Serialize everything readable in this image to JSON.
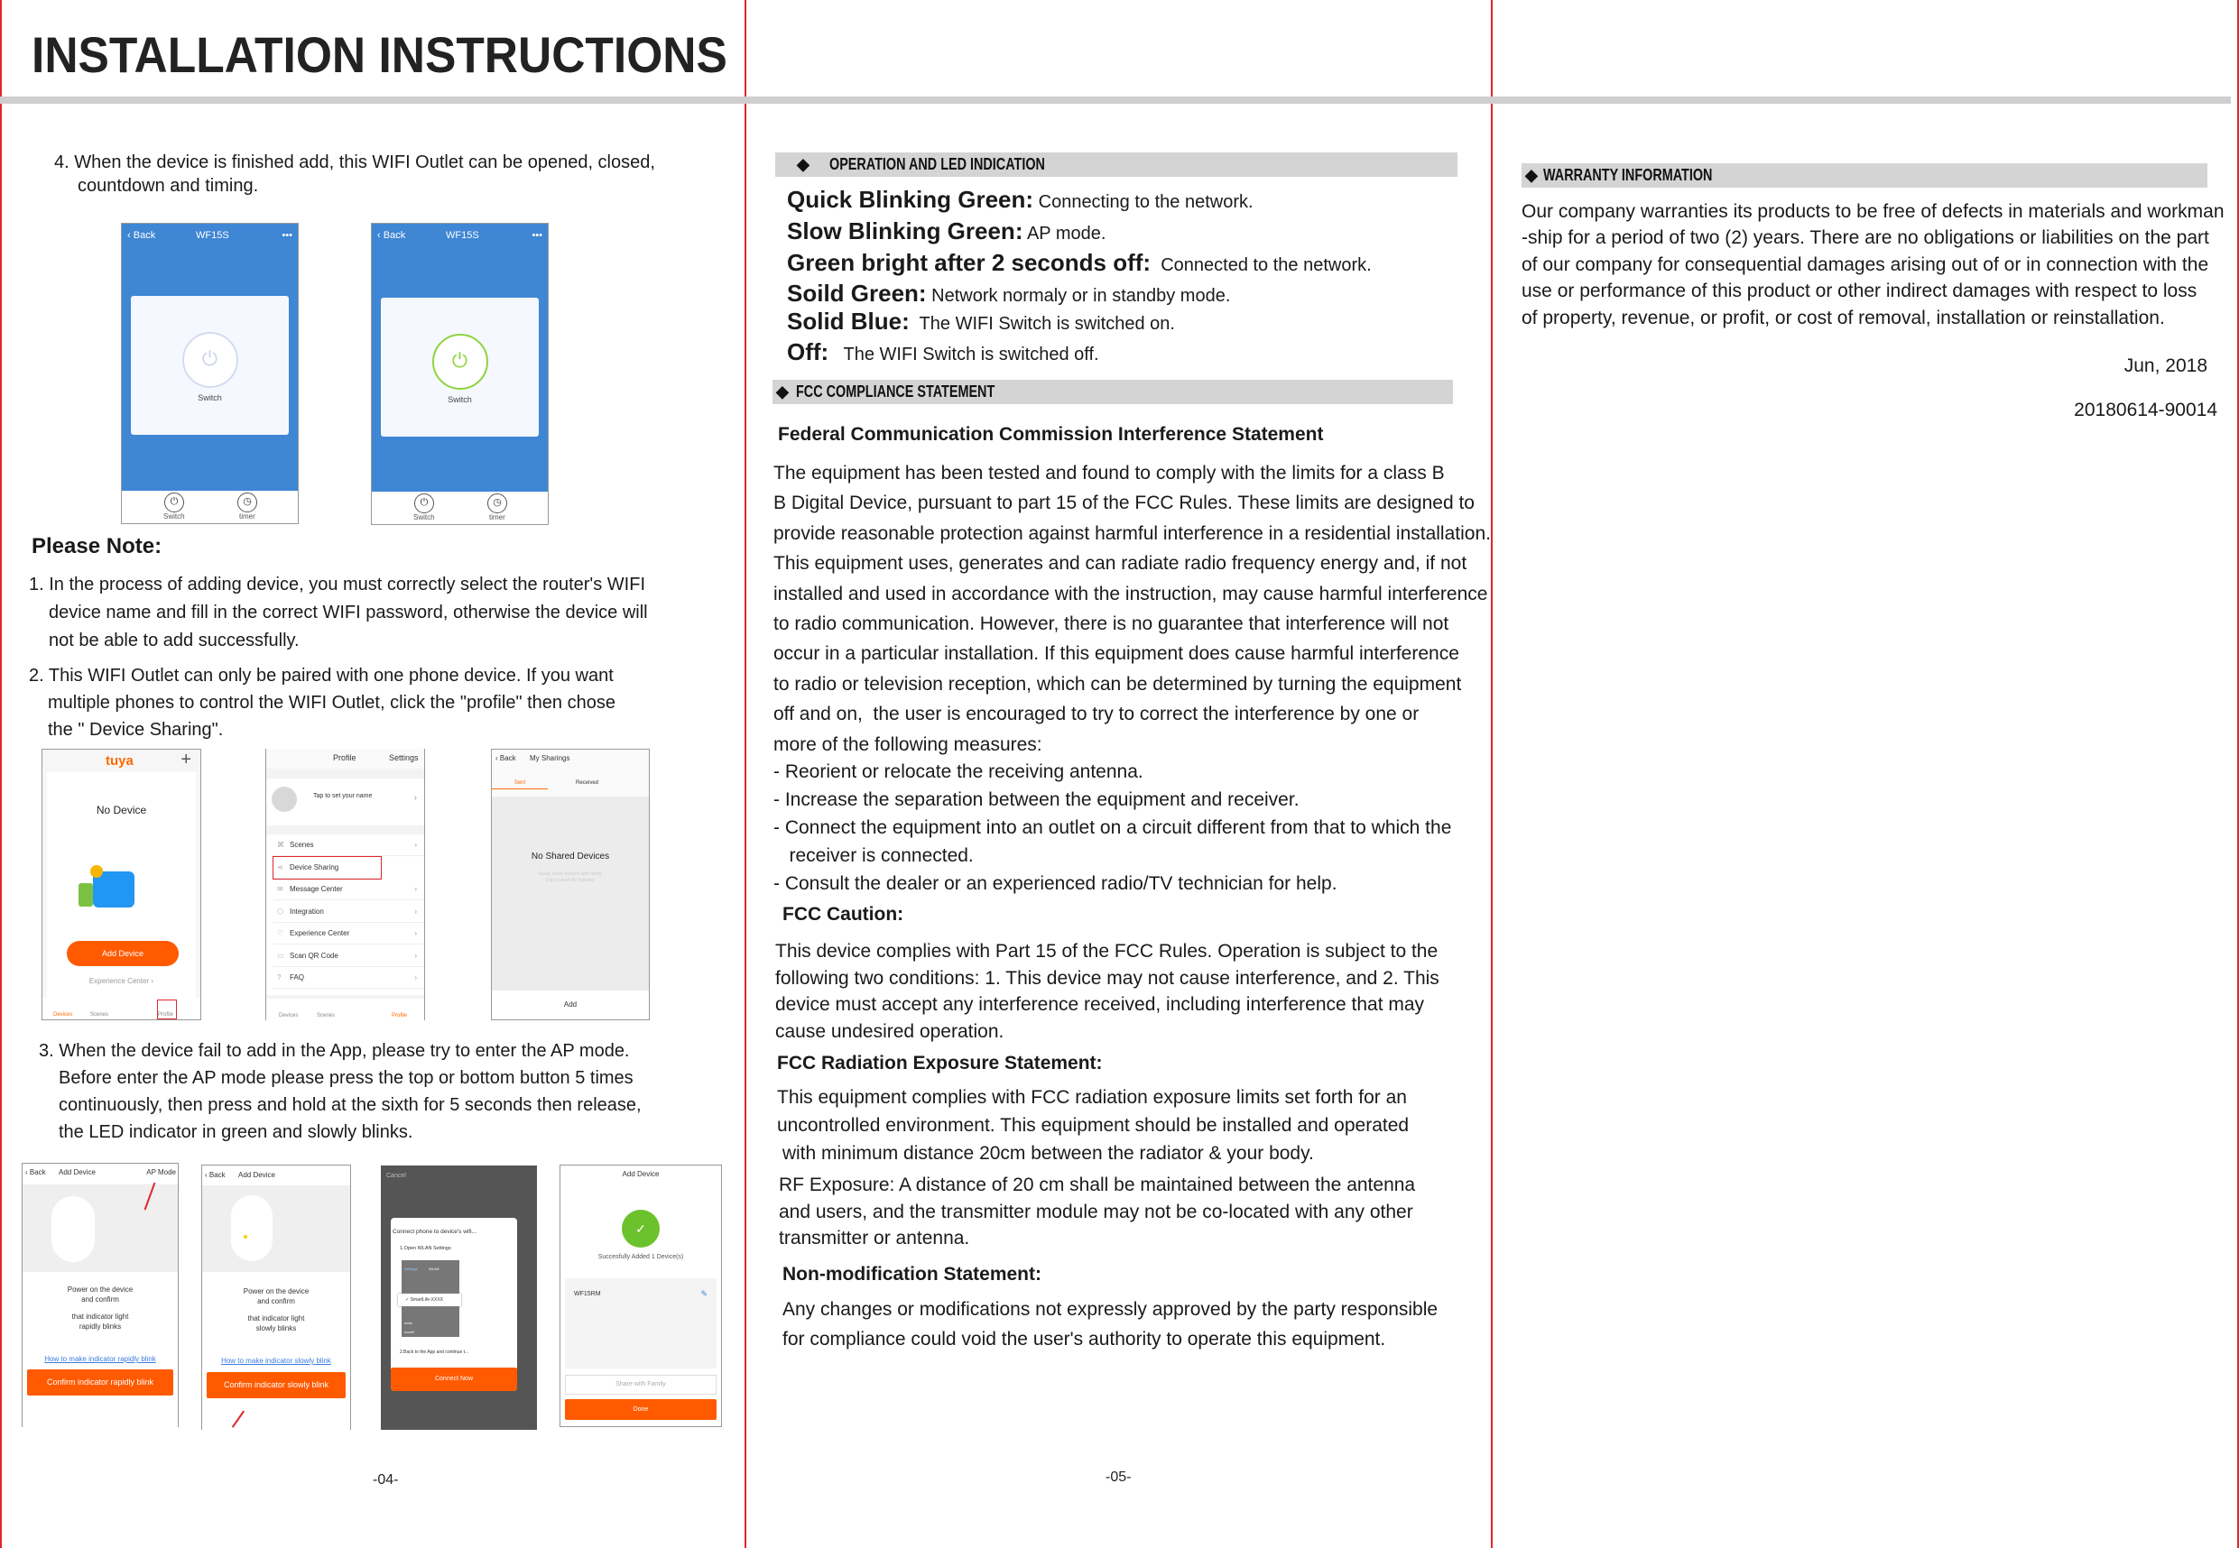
{
  "header": {
    "title": "INSTALLATION INSTRUCTIONS"
  },
  "colors": {
    "divider_red": "#e0262b",
    "section_bar": "#d4d4d4",
    "app_blue": "#3f86d4",
    "app_orange": "#ff5a00",
    "power_on_green": "#8ed33e"
  },
  "page4": {
    "step4": [
      "4. When the device is finished add, this WIFI Outlet can be opened, closed,",
      "countdown and timing."
    ],
    "control_phones": [
      {
        "back": "Back",
        "title": "WF15S",
        "menu": "•••",
        "switch_label": "Switch",
        "foot": [
          "Switch",
          "timer"
        ],
        "state": "off"
      },
      {
        "back": "Back",
        "title": "WF15S",
        "menu": "•••",
        "switch_label": "Switch",
        "foot": [
          "Switch",
          "timer"
        ],
        "state": "on"
      }
    ],
    "please_note": "Please Note:",
    "note1": [
      "1. In the process of adding device, you must correctly select the router's WIFI",
      "device name and fill in the correct WIFI password, otherwise the device will",
      "not be able to add successfully."
    ],
    "note2": [
      "2. This WIFI Outlet can only be paired with one phone device. If you want",
      "multiple phones to control the WIFI Outlet, click the \"profile\" then chose",
      "the \" Device Sharing\"."
    ],
    "home_phone": {
      "logo": "tuya",
      "plus": "+",
      "empty": "No Device",
      "add": "Add Device",
      "exp": "Experience Center ›",
      "tabs": [
        "Devices",
        "Scenes",
        "Profile"
      ]
    },
    "profile_phone": {
      "title": "Profile",
      "settings": "Settings",
      "name": "Tap to set your name",
      "items": [
        "Scenes",
        "Device Sharing",
        "Message Center",
        "Integration",
        "Experience Center",
        "Scan QR Code",
        "FAQ"
      ],
      "tabs": [
        "Devices",
        "Scenes",
        "Profile"
      ]
    },
    "sharing_phone": {
      "back": "Back",
      "title": "My Sharings",
      "tabs": [
        "Sent",
        "Received"
      ],
      "empty": "No Shared Devices",
      "hint": [
        "Easily share devices with family",
        "Enjoy smart life together"
      ],
      "add": "Add"
    },
    "step3": [
      "3. When the device fail to add in the App, please try to enter the AP mode.",
      "Before enter the AP mode please press the top or bottom button 5 times",
      "continuously, then press and hold at the sixth for 5 seconds then release,",
      "the LED indicator in green and slowly blinks."
    ],
    "ap_phone1": {
      "back": "Back",
      "title": "Add Device",
      "mode": "AP Mode",
      "text": [
        "Power on the device",
        "and confirm",
        "",
        "that indicator light",
        "rapidly blinks"
      ],
      "link": "How to make indicator rapidly blink",
      "button": "Confirm indicator rapidly blink"
    },
    "ap_phone2": {
      "back": "Back",
      "title": "Add Device",
      "text": [
        "Power on the device",
        "and confirm",
        "",
        "that indicator light",
        "slowly blinks"
      ],
      "link": "How to make indicator slowly blink",
      "button": "Confirm indicator slowly blink"
    },
    "ap_phone3": {
      "cancel": "Cancel",
      "title": "Connect phone to device's wifi...",
      "step1": "1.Open WLAN Settings",
      "wlan": "WLAN",
      "settings": "Settings",
      "network": "SmartLife-XXXX",
      "others": [
        "none",
        "none2"
      ],
      "step2": "2.Back to the App and continue t...",
      "button": "Connect Now"
    },
    "ap_phone4": {
      "title": "Add Device",
      "success": "Succesfully Added 1 Device(s)",
      "device": "WF15RM",
      "share": "Share with Family",
      "done": "Done"
    },
    "page_number": "-04-"
  },
  "page5": {
    "section1": "OPERATION AND LED INDICATION",
    "led": [
      {
        "label": "Quick Blinking Green:",
        "text": "Connecting to the network."
      },
      {
        "label": "Slow Blinking Green:",
        "text": "AP mode."
      },
      {
        "label": "Green bright after 2 seconds off:",
        "text": "Connected to the network."
      },
      {
        "label": "Soild Green:",
        "text": "Network normaly or in standby mode."
      },
      {
        "label": "Solid Blue:",
        "text": "The WIFI Switch is switched on."
      },
      {
        "label": "Off:",
        "text": "The WIFI Switch is switched off."
      }
    ],
    "section2": "FCC  COMPLIANCE  STATEMENT",
    "fcc_heading": "Federal Communication Commission Interference Statement",
    "fcc_para": [
      "The equipment has been tested and found to comply with the limits for a class B",
      "B Digital Device, pursuant to part 15 of the FCC Rules. These limits are designed to",
      "provide reasonable protection against harmful interference in a residential installation.",
      "This equipment uses, generates and can radiate radio frequency energy and, if not",
      "installed and used in accordance with the instruction, may cause harmful interference",
      "to radio communication. However, there is no guarantee that interference will not",
      "occur in a particular installation. If this equipment does cause harmful interference",
      "to radio or television reception, which can be determined by turning the equipment",
      "off and on,  the user is encouraged to try to correct the interference by one or",
      "more of the following measures:"
    ],
    "measures": [
      "- Reorient or relocate the receiving antenna.",
      "- Increase the separation between the equipment and receiver.",
      "- Connect the equipment into an outlet on a circuit different from that to which the",
      "   receiver is connected.",
      "- Consult the dealer or an experienced radio/TV technician for help."
    ],
    "caution_heading": "FCC Caution:",
    "caution": [
      "This device complies with Part 15 of the FCC Rules. Operation is subject to the",
      "following two conditions: 1. This device may not cause interference, and 2. This",
      "device must accept any interference received, including interference that may",
      "cause undesired operation."
    ],
    "radiation_heading": "FCC Radiation Exposure Statement:",
    "radiation": [
      "This equipment complies with FCC radiation exposure limits set forth for an",
      "uncontrolled environment. This equipment should be installed and operated",
      " with minimum distance 20cm between the radiator & your body."
    ],
    "rf": [
      "RF Exposure: A distance of 20 cm shall be maintained between the antenna",
      "and users, and the transmitter module may not be co-located with any other",
      "transmitter or antenna."
    ],
    "nonmod_heading": "Non-modification Statement:",
    "nonmod": [
      "Any changes or modifications not expressly approved by the party responsible",
      "for compliance could void the user's authority to operate this equipment."
    ],
    "page_number": "-05-"
  },
  "page6": {
    "section": "WARRANTY INFORMATION",
    "para": [
      "Our company warranties its products to be free of defects in materials and workman",
      "-ship for a period of two (2) years. There are no obligations or liabilities on the part",
      "of our company for consequential damages arising out of or in connection with the",
      "use or performance of this product or other indirect damages with respect to loss",
      "of property, revenue, or profit, or cost of removal, installation or reinstallation."
    ],
    "date": "Jun, 2018",
    "code": "20180614-90014"
  }
}
